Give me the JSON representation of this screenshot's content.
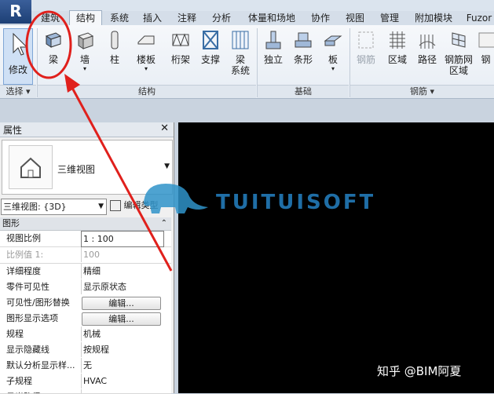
{
  "app_button": "R",
  "tabs": [
    {
      "label": "建筑",
      "active": false
    },
    {
      "label": "结构",
      "active": true
    },
    {
      "label": "系统",
      "active": false
    },
    {
      "label": "插入",
      "active": false
    },
    {
      "label": "注释",
      "active": false
    },
    {
      "label": "分析",
      "active": false
    },
    {
      "label": "体量和场地",
      "active": false
    },
    {
      "label": "协作",
      "active": false
    },
    {
      "label": "视图",
      "active": false
    },
    {
      "label": "管理",
      "active": false
    },
    {
      "label": "附加模块",
      "active": false
    },
    {
      "label": "Fuzor",
      "active": false
    }
  ],
  "ribbon": {
    "select_group": {
      "tool": "修改",
      "label": "选择"
    },
    "structure_group": {
      "label": "结构",
      "tools": [
        "梁",
        "墙",
        "柱",
        "楼板",
        "桁架",
        "支撑",
        "梁\n系统"
      ]
    },
    "foundation_group": {
      "label": "基础",
      "tools": [
        "独立",
        "条形",
        "板"
      ]
    },
    "rebar_group": {
      "label": "钢筋",
      "tools": [
        {
          "label": "钢筋",
          "disabled": true
        },
        {
          "label": "区域",
          "disabled": false
        },
        {
          "label": "路径",
          "disabled": false
        },
        {
          "label": "钢筋网\n区域",
          "disabled": false
        },
        {
          "label": "钢",
          "disabled": false
        }
      ]
    }
  },
  "properties": {
    "title": "属性",
    "type_name": "三维视图",
    "view_select": "三维视图: {3D}",
    "edit_type": "编辑类型",
    "section": "图形",
    "rows": [
      {
        "key": "视图比例",
        "value": "1 : 100",
        "kind": "input"
      },
      {
        "key": "比例值 1:",
        "value": "100",
        "kind": "disabled"
      },
      {
        "key": "详细程度",
        "value": "精细",
        "kind": "text"
      },
      {
        "key": "零件可见性",
        "value": "显示原状态",
        "kind": "text"
      },
      {
        "key": "可见性/图形替换",
        "value": "编辑...",
        "kind": "button"
      },
      {
        "key": "图形显示选项",
        "value": "编辑...",
        "kind": "button"
      },
      {
        "key": "规程",
        "value": "机械",
        "kind": "text"
      },
      {
        "key": "显示隐藏线",
        "value": "按规程",
        "kind": "text"
      },
      {
        "key": "默认分析显示样...",
        "value": "无",
        "kind": "text"
      },
      {
        "key": "子规程",
        "value": "HVAC",
        "kind": "text"
      },
      {
        "key": "日光路径",
        "value": "",
        "kind": "text"
      }
    ]
  },
  "watermark": "TUITUISOFT",
  "caption": "知乎 @BIM阿夏",
  "colors": {
    "annotation_red": "#e0201c",
    "canvas": "#000000",
    "ribbon_active": "#cfe0f5"
  }
}
